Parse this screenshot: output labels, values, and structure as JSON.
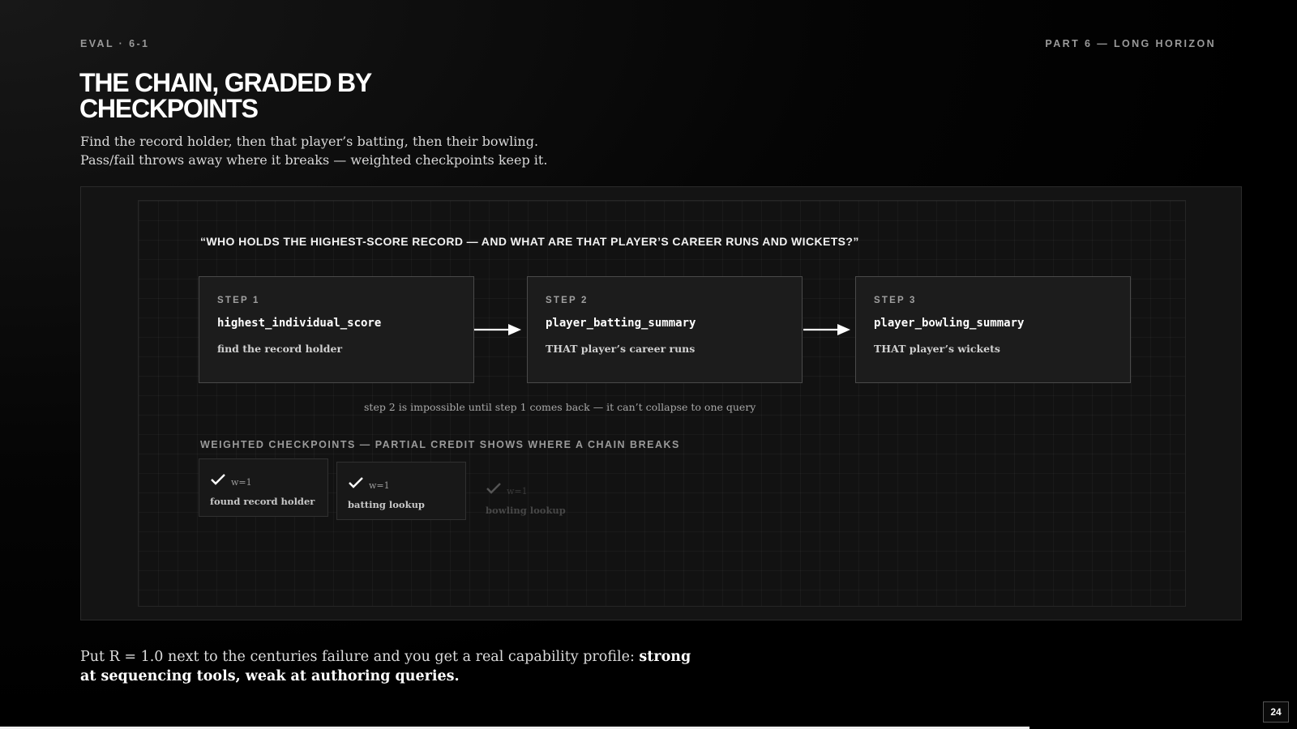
{
  "header": {
    "eyebrow_left": "EVAL · 6-1",
    "eyebrow_right": "PART 6 — LONG HORIZON"
  },
  "title": "THE CHAIN, GRADED BY CHECKPOINTS",
  "subtitle": "Find the record holder, then that player’s batting, then their bowling. Pass/fail throws away where it breaks — weighted checkpoints keep it.",
  "diagram": {
    "question": "“WHO HOLDS THE HIGHEST-SCORE RECORD — AND WHAT ARE THAT PLAYER’S CAREER RUNS AND WICKETS?”",
    "steps": [
      {
        "label": "STEP 1",
        "tool": "highest_individual_score",
        "desc": "find the record holder"
      },
      {
        "label": "STEP 2",
        "tool": "player_batting_summary",
        "desc": "THAT player’s career runs"
      },
      {
        "label": "STEP 3",
        "tool": "player_bowling_summary",
        "desc": "THAT player’s wickets"
      }
    ],
    "note": "step 2 is impossible until step 1 comes back — it can’t collapse to one query",
    "checkpoints_heading": "WEIGHTED CHECKPOINTS — PARTIAL CREDIT SHOWS WHERE A CHAIN BREAKS",
    "checkpoints": [
      {
        "weight": "w=1",
        "label": "found record holder",
        "state": "passed"
      },
      {
        "weight": "w=1",
        "label": "batting lookup",
        "state": "passed"
      },
      {
        "weight": "w=1",
        "label": "bowling lookup",
        "state": "pending"
      }
    ]
  },
  "footer": {
    "text": "Put R = 1.0 next to the centuries failure and you get a real capability profile: ",
    "emphasis": "strong at sequencing tools, weak at authoring queries."
  },
  "page_number": "24",
  "colors": {
    "background": "#000000",
    "panel": "#141414",
    "step_border": "#4a4a4a",
    "text": "#ffffff",
    "muted": "#9a9a9a"
  }
}
